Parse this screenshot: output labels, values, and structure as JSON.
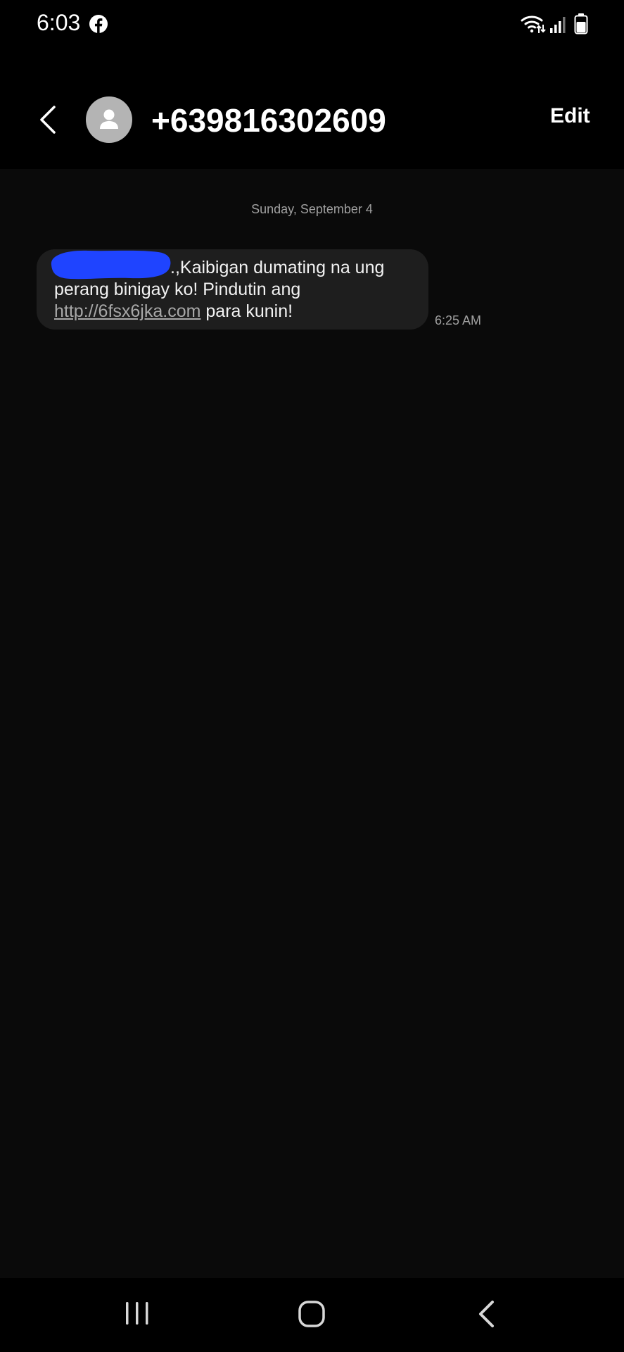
{
  "status_bar": {
    "time": "6:03",
    "icons": [
      "facebook-icon",
      "wifi-icon",
      "signal-icon",
      "battery-icon"
    ]
  },
  "header": {
    "contact_number": "+639816302609",
    "edit_label": "Edit",
    "icons": [
      "back-arrow-icon",
      "contact-avatar-icon"
    ]
  },
  "conversation": {
    "date_divider": "Sunday, September 4",
    "messages": [
      {
        "text_before_link": ".,Kaibigan dumating na ung perang binigay ko! Pindutin ang ",
        "link": "http://6fsx6jka.com",
        "text_after_link": " para kunin!",
        "time": "6:25 AM"
      }
    ]
  },
  "nav_bar": {
    "icons": [
      "recent-apps-icon",
      "home-icon",
      "back-icon"
    ]
  },
  "colors": {
    "background": "#0a0a0a",
    "header_background": "#000000",
    "bubble_background": "#1e1e1e",
    "secondary_text": "#a0a0a0",
    "redaction": "#1f44ff"
  }
}
